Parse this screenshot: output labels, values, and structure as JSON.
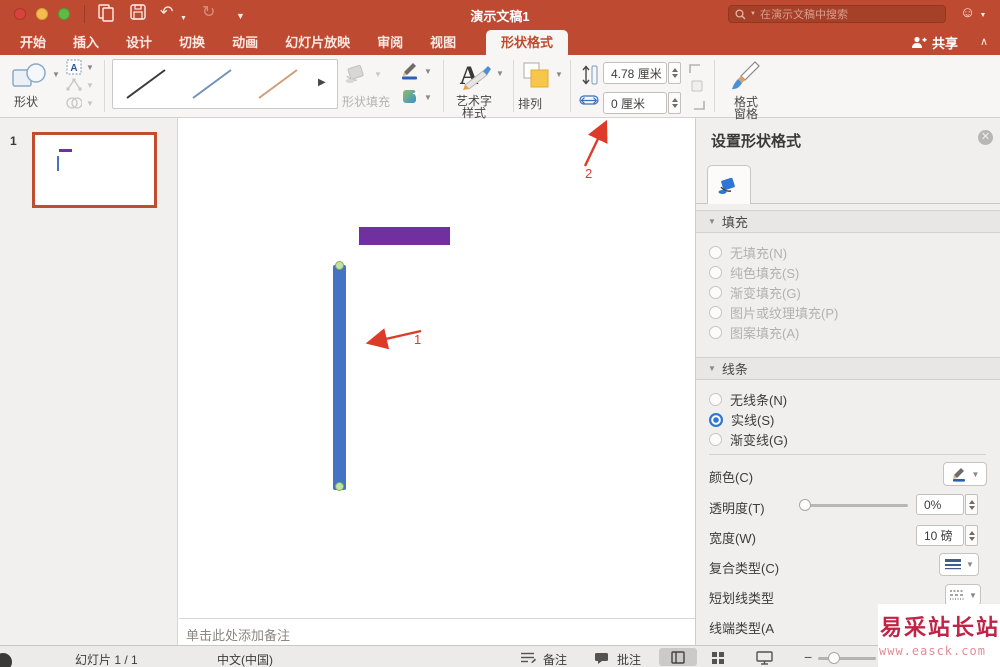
{
  "titlebar": {
    "title": "演示文稿1",
    "search_placeholder": "在演示文稿中搜索"
  },
  "tabs": {
    "items": [
      "开始",
      "插入",
      "设计",
      "切换",
      "动画",
      "幻灯片放映",
      "审阅",
      "视图"
    ],
    "active": "形状格式",
    "share": "共享"
  },
  "ribbon": {
    "shapes": "形状",
    "shape_fill": "形状填充",
    "wordart1": "艺术字",
    "wordart2": "样式",
    "arrange": "排列",
    "height_value": "4.78 厘米",
    "width_value": "0 厘米",
    "format_pane1": "格式",
    "format_pane2": "窗格"
  },
  "thumbs": {
    "slide_number": "1"
  },
  "annotations": {
    "a1": "1",
    "a2": "2"
  },
  "notes": {
    "placeholder": "单击此处添加备注"
  },
  "panel": {
    "title": "设置形状格式",
    "fill": {
      "header": "填充",
      "options": [
        "无填充(N)",
        "纯色填充(S)",
        "渐变填充(G)",
        "图片或纹理填充(P)",
        "图案填充(A)"
      ]
    },
    "line": {
      "header": "线条",
      "options": [
        "无线条(N)",
        "实线(S)",
        "渐变线(G)"
      ],
      "selected": "实线(S)"
    },
    "color_label": "颜色(C)",
    "transparency_label": "透明度(T)",
    "transparency_value": "0%",
    "width_label": "宽度(W)",
    "width_value": "10 磅",
    "compound_label": "复合类型(C)",
    "dash_label": "短划线类型",
    "cap_label": "线端类型(A"
  },
  "statusbar": {
    "slide_info": "幻灯片 1 / 1",
    "language": "中文(中国)",
    "notes": "备注",
    "comments": "批注"
  },
  "watermark": {
    "line1": "易采站长站",
    "line2": "www.easck.com"
  },
  "colors": {
    "titlebar_red": "#BE4A32",
    "shape_purple": "#7030A0",
    "shape_blue": "#4472C4",
    "arrow_red": "#DD3B2A",
    "watermark_red": "#C02346"
  }
}
